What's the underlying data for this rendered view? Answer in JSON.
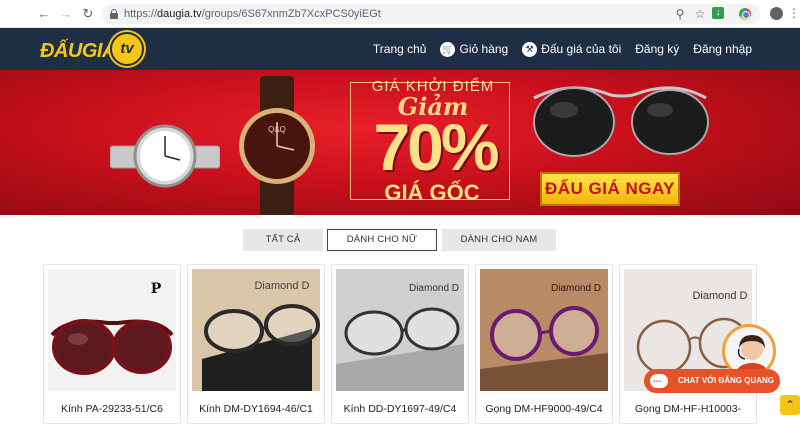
{
  "browser": {
    "url_scheme": "https://",
    "url_host": "daugia.tv",
    "url_path": "/groups/6S67xnmZb7XcxPCS0yiEGt",
    "icons": [
      "back-icon",
      "forward-icon",
      "reload-icon",
      "lock-icon",
      "key-icon",
      "star-icon",
      "extension-icon",
      "chrome-icon",
      "profile-icon",
      "menu-icon"
    ]
  },
  "site": {
    "logo_text": "ĐẤUGIÁ.",
    "logo_badge": "tv",
    "nav": {
      "home": "Trang chủ",
      "cart": "Giỏ hàng",
      "my_auctions": "Đấu giá của tôi",
      "register": "Đăng ký",
      "login": "Đăng nhập"
    }
  },
  "banner": {
    "line1": "GIÁ KHỞI ĐIỂM",
    "line2": "Giảm",
    "percent": "70%",
    "line3": "GIÁ GỐC",
    "cta": "ĐẤU GIÁ NGAY",
    "watch_brand": "Q&Q"
  },
  "tabs": {
    "all": "TẤT CẢ",
    "women": "DÀNH CHO NỮ",
    "men": "DÀNH CHO NAM"
  },
  "products": [
    {
      "title": "Kính PA-29233-51/C6",
      "brand": "P"
    },
    {
      "title": "Kính DM-DY1694-46/C1",
      "brand": "Diamond D"
    },
    {
      "title": "Kính DD-DY1697-49/C4",
      "brand": "Diamond D"
    },
    {
      "title": "Gọng DM-HF9000-49/C4",
      "brand": "Diamond D"
    },
    {
      "title": "Gọng DM-HF-H10003-",
      "brand": "Diamond D"
    }
  ],
  "chat": {
    "label": "CHAT VỚI ĐĂNG QUANG"
  },
  "colors": {
    "header_bg": "#1d2e45",
    "banner_red": "#c8101c",
    "gold": "#f5c518",
    "chat_orange": "#e8522a"
  }
}
